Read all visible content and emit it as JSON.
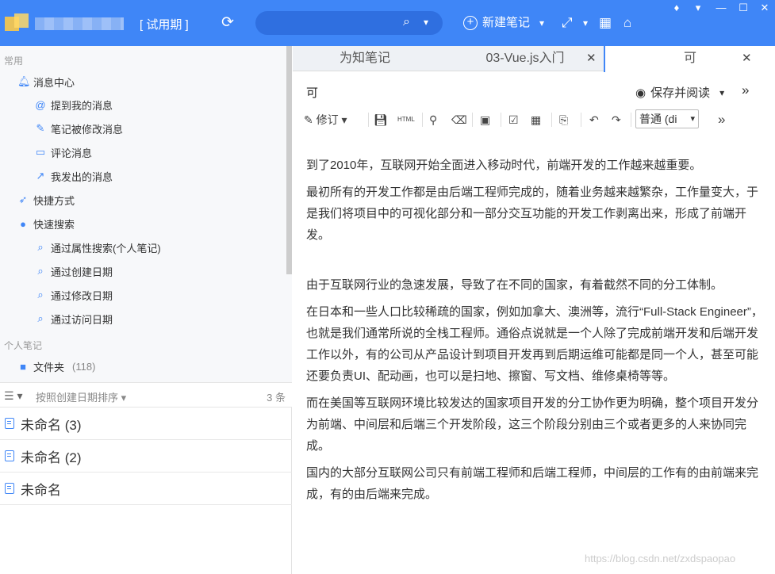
{
  "header": {
    "trial": "[ 试用期 ]",
    "new_note": "新建笔记",
    "accent": "#3f86f7"
  },
  "sidebar": {
    "section_common": "常用",
    "items": [
      {
        "label": "消息中心",
        "icon": "bell-icon"
      },
      {
        "label": "提到我的消息",
        "icon": "at-icon"
      },
      {
        "label": "笔记被修改消息",
        "icon": "edit-icon"
      },
      {
        "label": "评论消息",
        "icon": "comment-icon"
      },
      {
        "label": "我发出的消息",
        "icon": "share-icon"
      },
      {
        "label": "快捷方式",
        "icon": "rocket-icon"
      },
      {
        "label": "快速搜索",
        "icon": "search-icon"
      },
      {
        "label": "通过属性搜索(个人笔记)",
        "icon": "search-icon"
      },
      {
        "label": "通过创建日期",
        "icon": "search-icon"
      },
      {
        "label": "通过修改日期",
        "icon": "search-icon"
      },
      {
        "label": "通过访问日期",
        "icon": "search-icon"
      }
    ],
    "section_personal": "个人笔记",
    "folder": {
      "label": "文件夹",
      "count": "(118)"
    }
  },
  "list": {
    "sort_label": "按照创建日期排序",
    "count": "3 条",
    "notes": [
      "未命名 (3)",
      "未命名 (2)",
      "未命名"
    ]
  },
  "tabs": [
    {
      "label": "为知笔记"
    },
    {
      "label": "03-Vue.js入门"
    },
    {
      "label": "可"
    }
  ],
  "editor": {
    "title": "可",
    "save_read": "保存并阅读",
    "revise": "修订",
    "html_label": "HTML",
    "format_select": "普通 (di",
    "paragraphs": [
      "到了2010年，互联网开始全面进入移动时代，前端开发的工作越来越重要。",
      "最初所有的开发工作都是由后端工程师完成的，随着业务越来越繁杂，工作量变大，于是我们将项目中的可视化部分和一部分交互功能的开发工作剥离出来，形成了前端开发。",
      "由于互联网行业的急速发展，导致了在不同的国家，有着截然不同的分工体制。",
      "在日本和一些人口比较稀疏的国家，例如加拿大、澳洲等，流行“Full-Stack Engineer”，也就是我们通常所说的全栈工程师。通俗点说就是一个人除了完成前端开发和后端开发工作以外，有的公司从产品设计到项目开发再到后期运维可能都是同一个人，甚至可能还要负责UI、配动画，也可以是扫地、擦窗、写文档、维修桌椅等等。",
      "而在美国等互联网环境比较发达的国家项目开发的分工协作更为明确，整个项目开发分为前端、中间层和后端三个开发阶段，这三个阶段分别由三个或者更多的人来协同完成。",
      "国内的大部分互联网公司只有前端工程师和后端工程师，中间层的工作有的由前端来完成，有的由后端来完成。"
    ]
  },
  "watermark": "https://blog.csdn.net/zxdspaopao"
}
